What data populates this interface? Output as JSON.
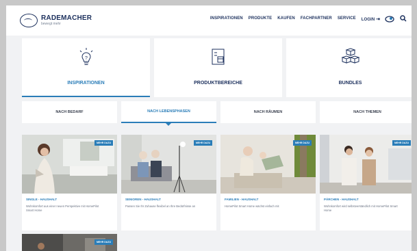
{
  "brand": {
    "name": "RADEMACHER",
    "tagline": "bewegt mehr"
  },
  "nav": [
    "INSPIRATIONEN",
    "PRODUKTE",
    "KAUFEN",
    "FACHPARTNER",
    "SERVICE",
    "LOGIN"
  ],
  "icons": {
    "login": "login-icon",
    "smart_home": "smart-home-icon",
    "search": "search-icon",
    "inspiration": "lightbulb-icon",
    "products": "checklist-box-icon",
    "bundles": "boxes-icon"
  },
  "categories": [
    {
      "label": "INSPIRATIONEN",
      "active": true
    },
    {
      "label": "PRODUKTBEREICHE",
      "active": false
    },
    {
      "label": "BUNDLES",
      "active": false
    }
  ],
  "filter_tabs": [
    {
      "label": "NACH BEDARF",
      "active": false
    },
    {
      "label": "NACH LEBENSPHASEN",
      "active": true
    },
    {
      "label": "NACH RÄUMEN",
      "active": false
    },
    {
      "label": "NACH THEMEN",
      "active": false
    }
  ],
  "tiles": [
    {
      "badge": "MEHR DAZU",
      "title": "SINGLE - HAUSHALT",
      "description": "Wohnkomfort aus einer neuen Perspektive mit HomePilot Smart Home"
    },
    {
      "badge": "MEHR DAZU",
      "title": "SENIOREN - HAUSHALT",
      "description": "Passen Sie Ihr Zuhause flexibel an Ihre Bedürfnisse an"
    },
    {
      "badge": "MEHR DAZU",
      "title": "FAMILIEN - HAUSHALT",
      "description": "HomePilot Smart Home wächst einfach mit"
    },
    {
      "badge": "MEHR DAZU",
      "title": "PÄRCHEN - HAUSHALT",
      "description": "Wohnkomfort wird selbstverständlich mit HomePilot Smart Home"
    }
  ],
  "next_tile": {
    "badge": "MEHR DAZU"
  },
  "colors": {
    "accent": "#2a7db8",
    "navy": "#1b2f5c",
    "bg": "#f1f2f4"
  }
}
